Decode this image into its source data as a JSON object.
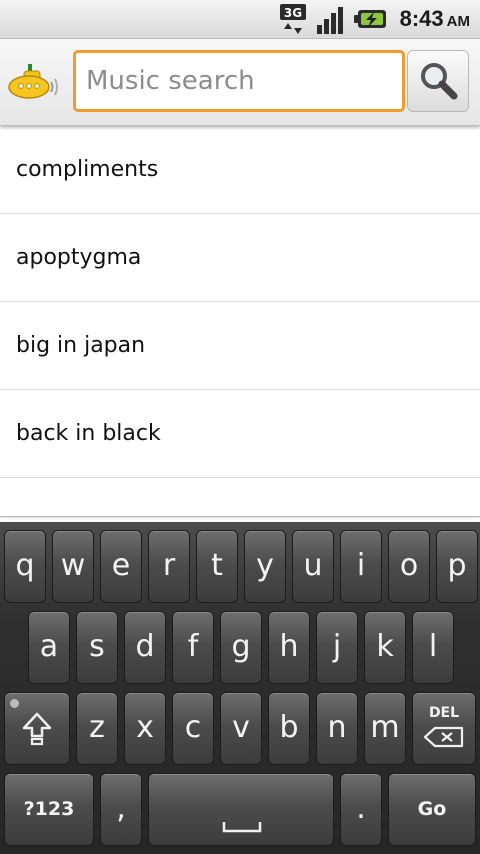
{
  "status_bar": {
    "network_type": "3G",
    "time": "8:43",
    "ampm": "AM",
    "icons": [
      "3g-data-icon",
      "signal-strength-icon",
      "battery-charging-icon"
    ]
  },
  "search": {
    "placeholder": "Music search",
    "value": "",
    "accent_color": "#f29a2e",
    "button_icon": "search-icon",
    "logo_icon": "yellow-submarine-logo"
  },
  "suggestions": [
    "compliments",
    "apoptygma",
    "big in japan",
    "back in black"
  ],
  "keyboard": {
    "row1": [
      "q",
      "w",
      "e",
      "r",
      "t",
      "y",
      "u",
      "i",
      "o",
      "p"
    ],
    "row2": [
      "a",
      "s",
      "d",
      "f",
      "g",
      "h",
      "j",
      "k",
      "l"
    ],
    "row3": [
      "z",
      "x",
      "c",
      "v",
      "b",
      "n",
      "m"
    ],
    "shift_icon": "shift-icon",
    "delete_label": "DEL",
    "symbols_label": "?123",
    "comma": ",",
    "period": ".",
    "space_icon": "space-bar-icon",
    "go_label": "Go"
  }
}
